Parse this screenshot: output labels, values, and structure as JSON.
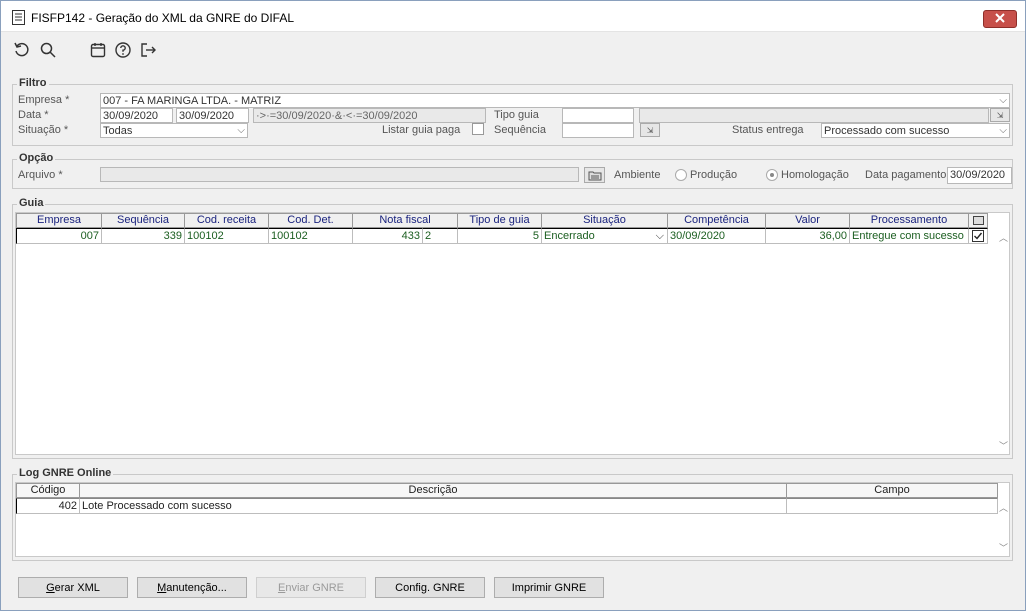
{
  "window": {
    "title": "FISFP142 - Geração do XML da GNRE do DIFAL",
    "close_icon": "close-icon"
  },
  "toolbar": {
    "icons": [
      "refresh-icon",
      "search-icon",
      "calendar-icon",
      "help-icon",
      "exit-icon"
    ]
  },
  "filtro": {
    "legend": "Filtro",
    "empresa_label": "Empresa *",
    "empresa_value": "007 - FA MARINGA LTDA. - MATRIZ",
    "data_label": "Data *",
    "data_from": "30/09/2020",
    "data_to": "30/09/2020",
    "data_expr": "·>·=30/09/2020·&·<·=30/09/2020",
    "tipo_guia_label": "Tipo guia",
    "tipo_guia_value": "",
    "situacao_label": "Situação *",
    "situacao_value": "Todas",
    "listar_guia_paga_label": "Listar guia paga",
    "sequencia_label": "Sequência",
    "sequencia_value": "",
    "status_entrega_label": "Status entrega",
    "status_entrega_value": "Processado com sucesso"
  },
  "opcao": {
    "legend": "Opção",
    "arquivo_label": "Arquivo *",
    "arquivo_value": "",
    "ambiente_label": "Ambiente",
    "producao_label": "Produção",
    "homologacao_label": "Homologação",
    "ambiente_selected": "Homologação",
    "data_pagamento_label": "Data pagamento",
    "data_pagamento_value": "30/09/2020"
  },
  "guia": {
    "legend": "Guia",
    "columns": [
      "Empresa",
      "Sequência",
      "Cod. receita",
      "Cod. Det.",
      "Nota fiscal",
      "Tipo de guia",
      "Situação",
      "Competência",
      "Valor",
      "Processamento"
    ],
    "rows": [
      {
        "empresa": "007",
        "sequencia": "339",
        "cod_receita": "100102",
        "cod_det": "100102",
        "nota_fiscal": "433",
        "nota_serie": "2",
        "tipo_guia": "5",
        "situacao": "Encerrado",
        "competencia": "30/09/2020",
        "valor": "36,00",
        "processamento": "Entregue com sucesso",
        "checked": true
      }
    ]
  },
  "log": {
    "legend": "Log GNRE Online",
    "columns": [
      "Código",
      "Descrição",
      "Campo"
    ],
    "rows": [
      {
        "codigo": "402",
        "descricao": "Lote Processado com sucesso",
        "campo": ""
      }
    ]
  },
  "buttons": {
    "gerar_xml": {
      "pre": "",
      "ul": "G",
      "post": "erar XML"
    },
    "manutencao": {
      "pre": "",
      "ul": "M",
      "post": "anutenção..."
    },
    "enviar_gnre": {
      "pre": "",
      "ul": "E",
      "post": "nviar GNRE"
    },
    "config_gnre": {
      "pre": "Config. GNRE",
      "ul": "",
      "post": ""
    },
    "imprimir_gnre": {
      "pre": "Imprimir GNRE",
      "ul": "",
      "post": ""
    }
  },
  "colors": {
    "grid_text": "#1b5e20",
    "header_text": "#1a237e",
    "close_button": "#c7504a"
  }
}
